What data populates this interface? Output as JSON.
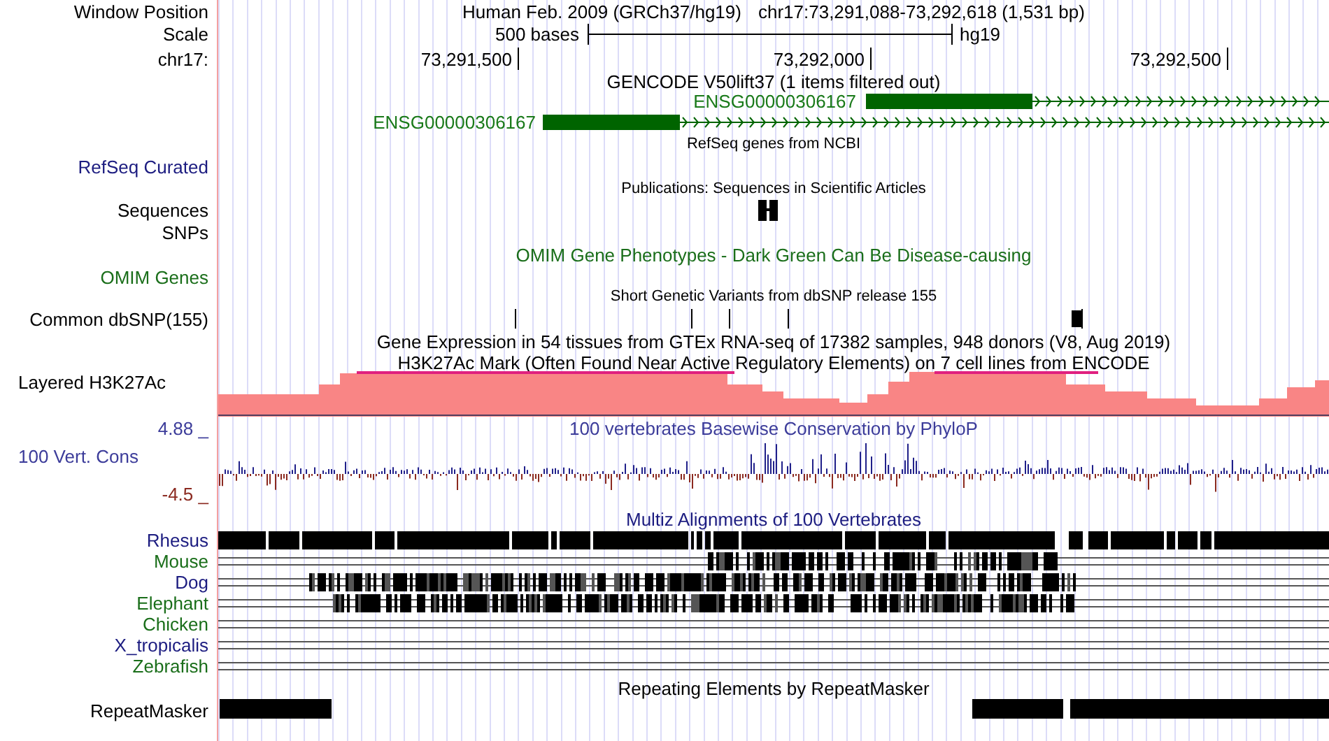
{
  "position": {
    "label": "Window Position",
    "assembly": "Human Feb. 2009 (GRCh37/hg19)",
    "range": "chr17:73,291,088-73,292,618 (1,531 bp)"
  },
  "scale": {
    "label": "Scale",
    "length": "500 bases",
    "assembly": "hg19"
  },
  "ruler": {
    "label": "chr17:",
    "ticks": [
      "73,291,500",
      "73,292,000",
      "73,292,500"
    ]
  },
  "gencode": {
    "title": "GENCODE V50lift37 (1 items filtered out)",
    "genes": [
      {
        "name": "ENSG00000306167"
      },
      {
        "name": "ENSG00000306167"
      }
    ]
  },
  "refseq": {
    "title": "RefSeq genes from NCBI",
    "label": "RefSeq Curated"
  },
  "publications": {
    "title": "Publications: Sequences in Scientific Articles",
    "tracks": [
      {
        "label": "Sequences"
      },
      {
        "label": "SNPs"
      }
    ]
  },
  "omim": {
    "title": "OMIM Gene Phenotypes - Dark Green Can Be Disease-causing",
    "label": "OMIM Genes"
  },
  "dbsnp": {
    "title": "Short Genetic Variants from dbSNP release 155",
    "label": "Common dbSNP(155)"
  },
  "gtex": {
    "title": "Gene Expression in 54 tissues from GTEx RNA-seq of 17382 samples, 948 donors (V8, Aug 2019)"
  },
  "h3k27ac": {
    "title": "H3K27Ac Mark (Often Found Near Active Regulatory Elements) on 7 cell lines from ENCODE",
    "label": "Layered H3K27Ac"
  },
  "conservation": {
    "title": "100 vertebrates Basewise Conservation by PhyloP",
    "label": "100 Vert. Cons",
    "max": "4.88 _",
    "min": "-4.5 _"
  },
  "multiz": {
    "title": "Multiz Alignments of 100 Vertebrates",
    "species": [
      {
        "name": "Rhesus",
        "color": "#1c1c80"
      },
      {
        "name": "Mouse",
        "color": "#1a6e1a"
      },
      {
        "name": "Dog",
        "color": "#1c1c80"
      },
      {
        "name": "Elephant",
        "color": "#1a6e1a"
      },
      {
        "name": "Chicken",
        "color": "#1a6e1a"
      },
      {
        "name": "X_tropicalis",
        "color": "#1c1c80"
      },
      {
        "name": "Zebrafish",
        "color": "#1a6e1a"
      }
    ]
  },
  "repeats": {
    "title": "Repeating Elements by RepeatMasker",
    "label": "RepeatMasker"
  }
}
